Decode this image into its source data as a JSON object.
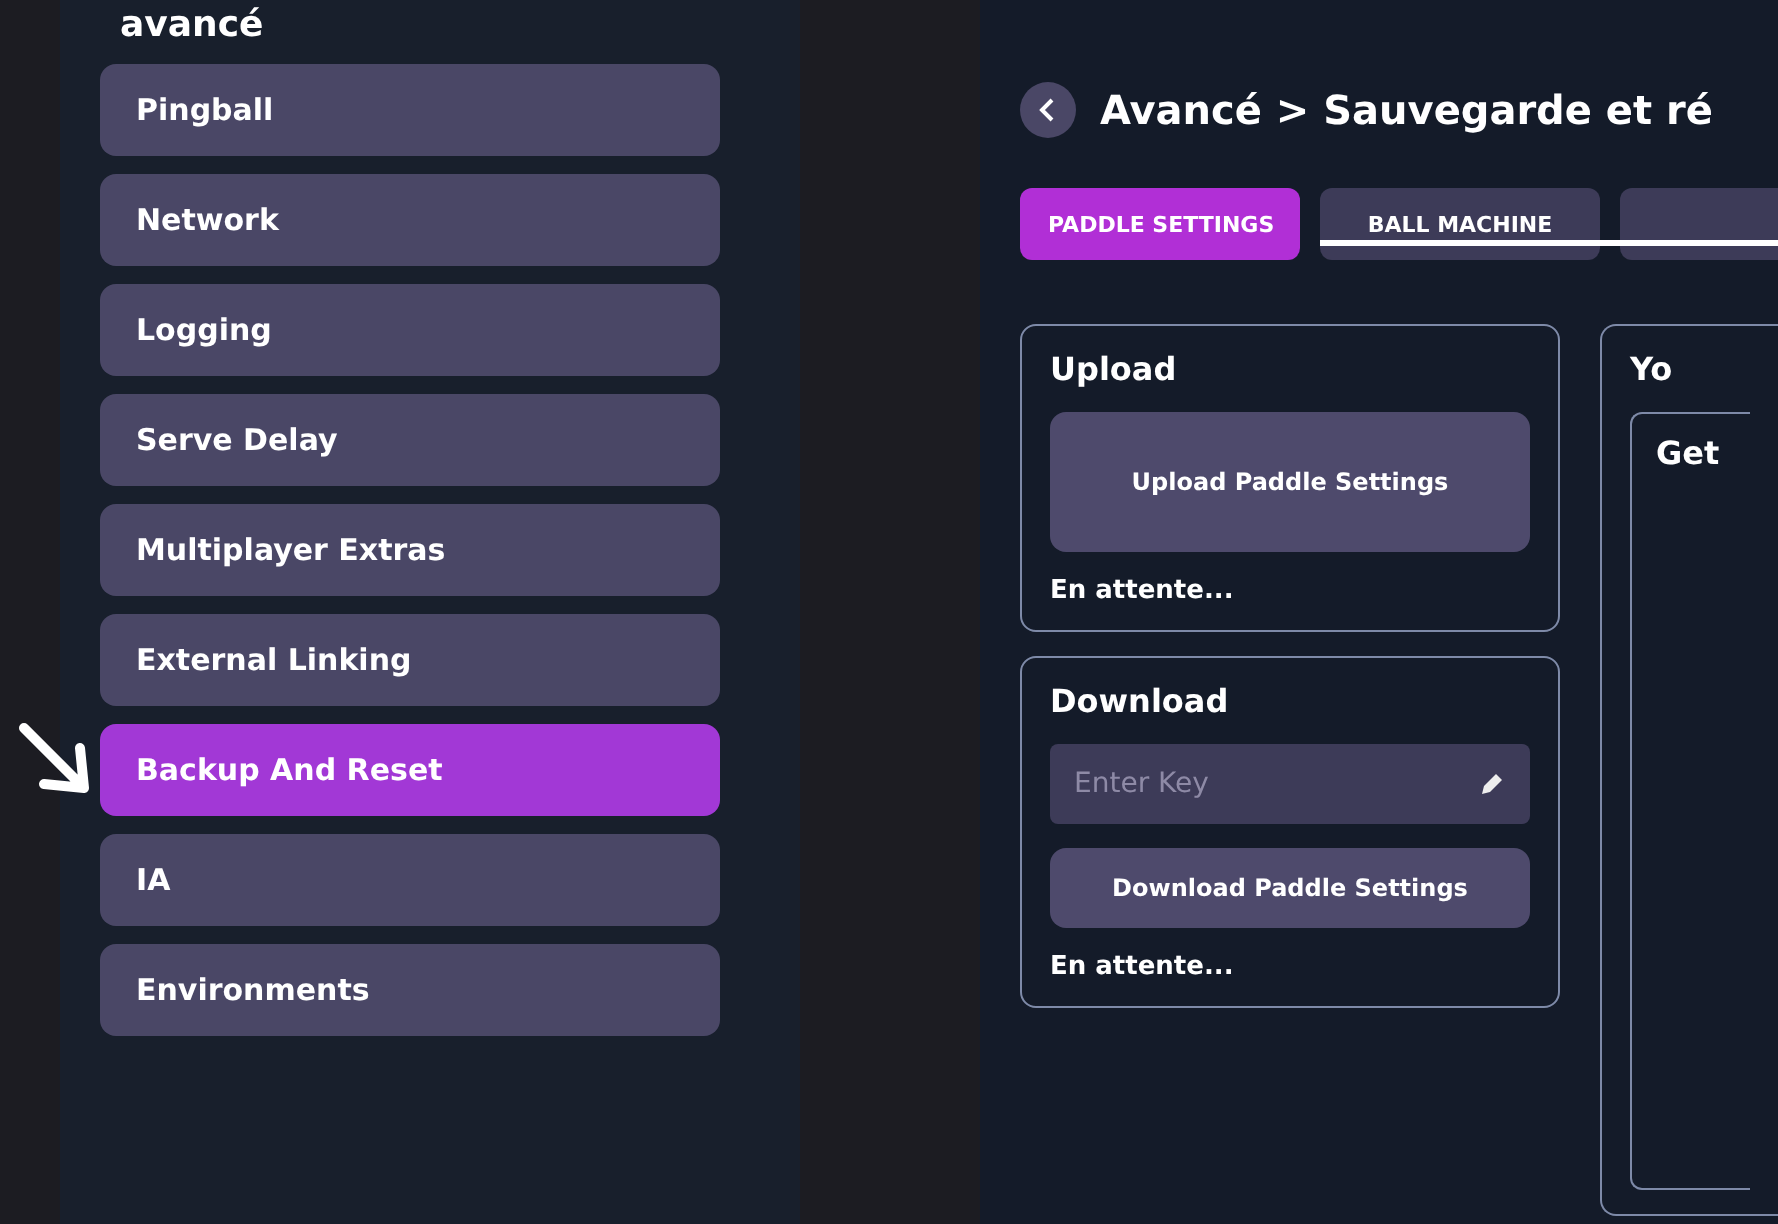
{
  "sidebar": {
    "title": "avancé",
    "items": [
      {
        "label": "Pingball",
        "selected": false
      },
      {
        "label": "Network",
        "selected": false
      },
      {
        "label": "Logging",
        "selected": false
      },
      {
        "label": "Serve Delay",
        "selected": false
      },
      {
        "label": "Multiplayer Extras",
        "selected": false
      },
      {
        "label": "External Linking",
        "selected": false
      },
      {
        "label": "Backup And Reset",
        "selected": true
      },
      {
        "label": "IA",
        "selected": false
      },
      {
        "label": "Environments",
        "selected": false
      }
    ]
  },
  "panel": {
    "title": "Avancé > Sauvegarde et ré",
    "tabs": [
      {
        "label": "PADDLE SETTINGS",
        "selected": true
      },
      {
        "label": "BALL MACHINE",
        "selected": false
      },
      {
        "selected": false
      }
    ],
    "upload": {
      "heading": "Upload",
      "button": "Upload Paddle Settings",
      "status": "En attente..."
    },
    "download": {
      "heading": "Download",
      "key_field": {
        "placeholder": "Enter Key"
      },
      "button": "Download Paddle Settings",
      "status": "En attente..."
    },
    "side_card": {
      "heading": "Yo",
      "inner_heading": "Get"
    }
  }
}
